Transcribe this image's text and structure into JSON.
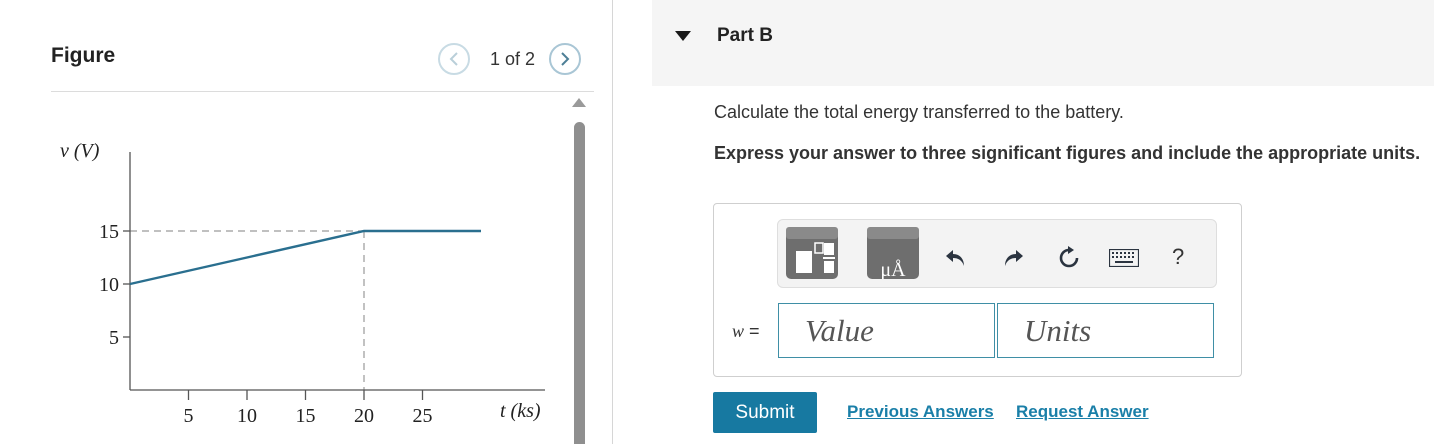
{
  "figure": {
    "title": "Figure",
    "pager": {
      "current": "1",
      "total": "2",
      "text": "1 of 2"
    }
  },
  "chart_data": {
    "type": "line",
    "xlabel": "t (ks)",
    "ylabel": "v (V)",
    "x_ticks": [
      5,
      10,
      15,
      20,
      25
    ],
    "y_ticks": [
      5,
      10,
      15
    ],
    "xlim": [
      0,
      30
    ],
    "ylim": [
      0,
      20
    ],
    "series": [
      {
        "x": [
          0,
          20,
          30
        ],
        "y": [
          10,
          15,
          15
        ]
      }
    ],
    "guides": {
      "horizontal_dashed_at_y": 15,
      "vertical_dashed_at_x": 20
    },
    "line_color": "#2a6f8f"
  },
  "part": {
    "title": "Part B",
    "question": "Calculate the total energy transferred to the battery.",
    "instruction": "Express your answer to three significant figures and include the appropriate units.",
    "variable": "w",
    "equals": "=",
    "value_placeholder": "Value",
    "units_placeholder": "Units",
    "toolbar": {
      "icons": [
        "templates-icon",
        "units-icon",
        "undo-icon",
        "redo-icon",
        "reset-icon",
        "keyboard-icon",
        "help-icon"
      ],
      "units_glyph": "μÅ",
      "help": "?"
    },
    "submit": "Submit",
    "previous_answers": "Previous Answers",
    "request_answer": "Request Answer"
  },
  "colors": {
    "accent": "#1779a1",
    "field_border": "#3f8fa6",
    "link": "#1a7fa8"
  }
}
